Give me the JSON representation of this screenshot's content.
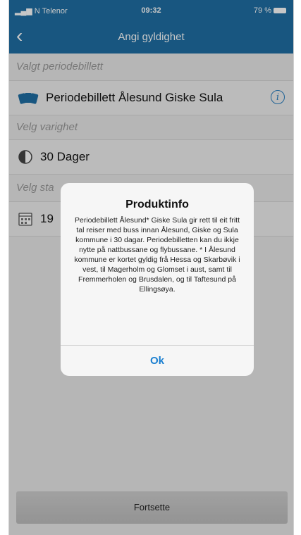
{
  "status_bar": {
    "carrier": "N Telenor",
    "time": "09:32",
    "battery": "79 %"
  },
  "nav": {
    "back_icon": "chevron-left-icon",
    "title": "Angi gyldighet"
  },
  "sections": {
    "ticket_label": "Valgt periodebillett",
    "ticket_value": "Periodebillett Ålesund Giske Sula",
    "duration_label": "Velg varighet",
    "duration_value": "30 Dager",
    "start_label": "Velg sta",
    "start_value": "19"
  },
  "dialog": {
    "title": "Produktinfo",
    "body": "Periodebillett Ålesund* Giske Sula gir rett til eit fritt tal reiser med buss innan Ålesund, Giske og Sula kommune i 30 dagar. Periodebilletten kan du ikkje nytte på nattbussane og flybussane. * I Ålesund kommune er kortet gyldig frå Hessa og Skarbøvik i vest, til Magerholm og Glomset i aust, samt til Fremmerholen og Brusdalen, og til Taftesund på Ellingsøya.",
    "ok_label": "Ok"
  },
  "footer": {
    "continue_label": "Fortsette"
  },
  "colors": {
    "header": "#1f6fa5",
    "accent": "#1a7fd0"
  }
}
